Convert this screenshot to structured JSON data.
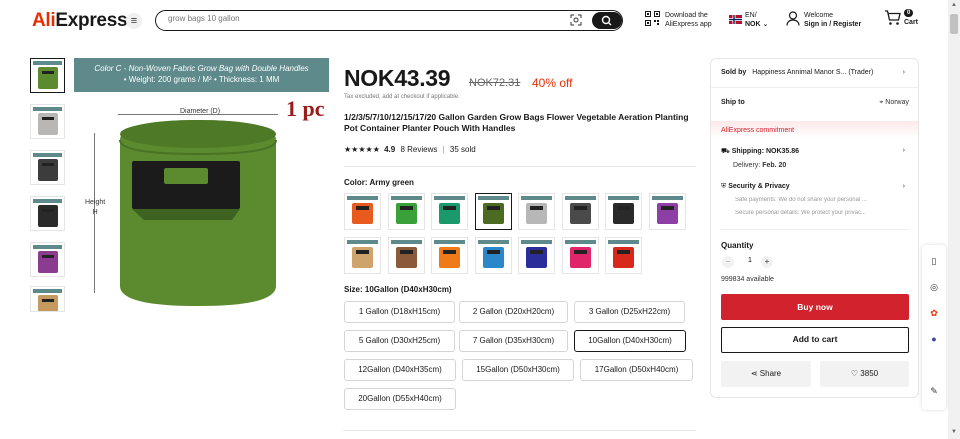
{
  "header": {
    "logo_ali": "Ali",
    "logo_express": "Express",
    "search_placeholder": "grow bags 10 gallon",
    "download_line1": "Download the",
    "download_line2": "AliExpress app",
    "lang_line1": "EN/",
    "lang_line2": "NOK",
    "welcome": "Welcome",
    "signin": "Sign in / Register",
    "cart_count": "0",
    "cart_label": "Cart"
  },
  "gallery": {
    "banner_line1": "Color C - Non-Woven Fabric Grow Bag with Double Handles",
    "banner_line2": "• Weight:  200 grams / M²   • Thickness: 1 MM",
    "pc_label": "1 pc",
    "diameter_label": "Diameter (D)",
    "height_label": "Height",
    "height_letter": "H",
    "thumbs": [
      {
        "color": "#5b8a2f"
      },
      {
        "color": "#b9b6b6"
      },
      {
        "color": "#3c3c3c"
      },
      {
        "color": "#2a2a2a"
      },
      {
        "color": "#8b3c8e"
      },
      {
        "color": "#c49a60"
      }
    ]
  },
  "product": {
    "price": "NOK43.39",
    "original_price": "NOK72.31",
    "discount": "40% off",
    "tax_note": "Tax excluded, add at checkout if applicable.",
    "title": "1/2/3/5/7/10/12/15/17/20 Gallon Garden Grow Bags Flower Vegetable Aeration Planting Pot Container Planter Pouch With Handles",
    "stars": "★★★★★",
    "rating": "4.9",
    "reviews": "8 Reviews",
    "sold": "35 sold",
    "color_label": "Color: Army green",
    "colors": [
      {
        "c": "#e85a1e"
      },
      {
        "c": "#3aa13a"
      },
      {
        "c": "#1a9a6c"
      },
      {
        "c": "#4c6b22"
      },
      {
        "c": "#b7b7b7"
      },
      {
        "c": "#4a4a4a"
      },
      {
        "c": "#2a2a2a"
      },
      {
        "c": "#8e3fa5"
      },
      {
        "c": "#cfa36c"
      },
      {
        "c": "#8a5a3a"
      },
      {
        "c": "#f07a18"
      },
      {
        "c": "#2a87c9"
      },
      {
        "c": "#2a2d9a"
      },
      {
        "c": "#e0256a"
      },
      {
        "c": "#d8281e"
      }
    ],
    "size_label": "Size: 10Gallon (D40xH30cm)",
    "sizes": [
      "1 Gallon (D18xH15cm)",
      "2 Gallon (D20xH20cm)",
      "3 Gallon (D25xH22cm)",
      "5 Gallon (D30xH25cm)",
      "7 Gallon (D35xH30cm)",
      "10Gallon (D40xH30cm)",
      "12Gallon (D40xH35cm)",
      "15Gallon (D50xH30cm)",
      "17Gallon (D50xH40cm)",
      "20Gallon (D55xH40cm)"
    ]
  },
  "panel": {
    "sold_by_label": "Sold by",
    "sold_by_value": "Happiness Annimal Manor S... (Trader)",
    "ship_to_label": "Ship to",
    "ship_to_value": "Norway",
    "commitment": "AliExpress commitment",
    "shipping": "Shipping: NOK35.86",
    "delivery_prefix": "Delivery: ",
    "delivery_date": "Feb. 20",
    "security": "Security & Privacy",
    "safe_payments": "Safe payments: We do not share your personal ...",
    "secure_details": "Secure personal details: We protect your privac...",
    "quantity_label": "Quantity",
    "quantity_value": "1",
    "available": "999834 available",
    "buy_now": "Buy now",
    "add_to_cart": "Add to cart",
    "share": "Share",
    "wishlist_count": "3850"
  },
  "colors": {
    "accent": "#d2222d",
    "brand": "#e62e04"
  }
}
